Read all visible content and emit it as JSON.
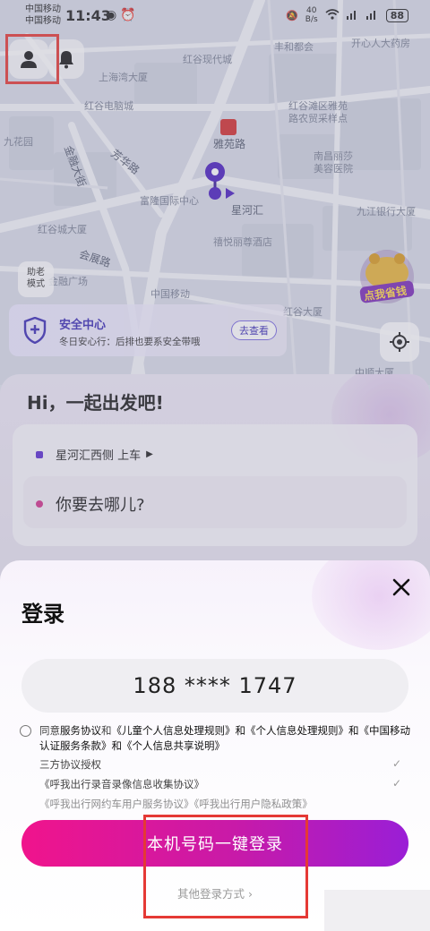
{
  "status_bar": {
    "carrier_1": "中国移动",
    "carrier_2": "中国移动",
    "time": "11:43",
    "net_speed_value": "40",
    "net_speed_unit": "B/s",
    "battery": "88"
  },
  "map": {
    "labels": [
      "开心人大药房",
      "丰和都会",
      "上海湾大厦",
      "红谷现代城",
      "红谷电脑城",
      "红谷滩区雅苑",
      "路农贸采样点",
      "雅苑路",
      "南昌丽莎",
      "美容医院",
      "芳华路",
      "富隆国际中心",
      "星河汇",
      "九江银行大厦",
      "红谷城大厦",
      "禧悦丽尊酒店",
      "会展路",
      "金融广场",
      "中国移动",
      "红谷大厦",
      "九花园",
      "金融大街",
      "中顺大厦"
    ]
  },
  "elder_mode": {
    "line1": "助老",
    "line2": "模式"
  },
  "promo": {
    "label": "点我省钱"
  },
  "safety_center": {
    "title": "安全中心",
    "subtitle": "冬日安心行：后排也要系安全带哦",
    "action": "去查看"
  },
  "booking": {
    "greeting": "Hi，一起出发吧!",
    "pickup": "星河汇西侧 上车",
    "destination_placeholder": "你要去哪儿?"
  },
  "login": {
    "title": "登录",
    "phone": "188 **** 1747",
    "agreement_prefix": "同意",
    "agreement_link_1": "服务协议",
    "agreement_mid": "和",
    "agreement_rest": "《儿童个人信息处理规则》和《个人信息处理规则》和《中国移动认证服务条款》和《个人信息共享说明》",
    "third_party_title": "三方协议授权",
    "third_party_1": "《呼我出行录音录像信息收集协议》",
    "third_party_2": "《呼我出行网约车用户服务协议》《呼我出行用户隐私政策》",
    "primary_button": "本机号码一键登录",
    "other_login": "其他登录方式 ›"
  }
}
